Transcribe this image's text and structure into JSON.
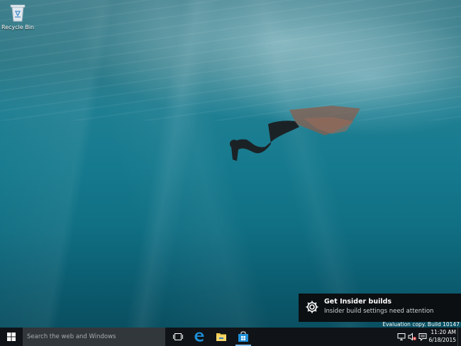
{
  "desktop": {
    "icons": [
      {
        "label": "Recycle Bin",
        "icon": "recycle-bin-icon"
      }
    ],
    "watermark": "Evaluation copy. Build 10147"
  },
  "notification": {
    "icon": "gear-icon",
    "title": "Get Insider builds",
    "body": "Insider build settings need attention"
  },
  "taskbar": {
    "start_icon": "windows-logo-icon",
    "search_placeholder": "Search the web and Windows",
    "pinned": [
      {
        "name": "Task View",
        "icon": "task-view-icon"
      },
      {
        "name": "Microsoft Edge",
        "icon": "edge-icon"
      },
      {
        "name": "File Explorer",
        "icon": "folder-icon"
      },
      {
        "name": "Store",
        "icon": "store-icon"
      }
    ],
    "tray": {
      "icons": [
        "network-icon",
        "volume-muted-icon",
        "action-center-icon"
      ],
      "time": "11:20 AM",
      "date": "6/18/2015"
    }
  },
  "colors": {
    "taskbar_bg": "#101418",
    "search_bg": "#32373b",
    "toast_bg": "#0b0f12",
    "accent": "#1e8fd8"
  }
}
